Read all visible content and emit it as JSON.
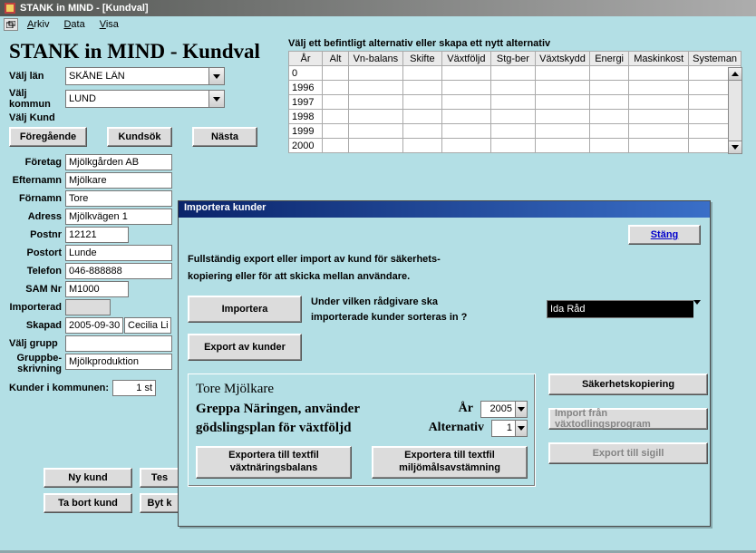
{
  "window": {
    "title": "STANK in MIND - [Kundval]"
  },
  "menubar": {
    "items": [
      "Arkiv",
      "Data",
      "Visa"
    ]
  },
  "app_title": "STANK in MIND - Kundval",
  "selectors": {
    "lan_label": "Välj län",
    "lan_value": "SKÅNE LÄN",
    "kommun_label": "Välj kommun",
    "kommun_value": "LUND",
    "kund_label": "Välj Kund"
  },
  "nav": {
    "prev": "Föregående",
    "search": "Kundsök",
    "next": "Nästa"
  },
  "fields": {
    "foretag_label": "Företag",
    "foretag": "Mjölkgården AB",
    "efternamn_label": "Efternamn",
    "efternamn": "Mjölkare",
    "fornamn_label": "Förnamn",
    "fornamn": "Tore",
    "adress_label": "Adress",
    "adress": "Mjölkvägen 1",
    "postnr_label": "Postnr",
    "postnr": "12121",
    "postort_label": "Postort",
    "postort": "Lunde",
    "telefon_label": "Telefon",
    "telefon": "046-888888",
    "samnr_label": "SAM Nr",
    "samnr": "M1000",
    "importerad_label": "Importerad",
    "importerad": "",
    "skapad_label": "Skapad",
    "skapad_date": "2005-09-30",
    "skapad_by": "Cecilia Li",
    "valj_grupp_label": "Välj grupp",
    "gruppbe_label": "Gruppbe-\nskrivning",
    "gruppbe": "Mjölkproduktion",
    "kunder_i_kommunen_label": "Kunder i kommunen:",
    "kunder_i_kommunen": "1 st"
  },
  "bottom": {
    "ny_kund": "Ny kund",
    "test": "Tes",
    "ta_bort": "Ta bort kund",
    "byt_k": "Byt k"
  },
  "grid": {
    "caption": "Välj ett befintligt alternativ eller skapa ett nytt alternativ",
    "headers": [
      "År",
      "Alt",
      "Vn-balans",
      "Skifte",
      "Växtföljd",
      "Stg-ber",
      "Växtskydd",
      "Energi",
      "Maskinkost",
      "Systeman"
    ],
    "rows": [
      [
        "0",
        "",
        "",
        "",
        "",
        "",
        "",
        "",
        "",
        ""
      ],
      [
        "1996",
        "",
        "",
        "",
        "",
        "",
        "",
        "",
        "",
        ""
      ],
      [
        "1997",
        "",
        "",
        "",
        "",
        "",
        "",
        "",
        "",
        ""
      ],
      [
        "1998",
        "",
        "",
        "",
        "",
        "",
        "",
        "",
        "",
        ""
      ],
      [
        "1999",
        "",
        "",
        "",
        "",
        "",
        "",
        "",
        "",
        ""
      ],
      [
        "2000",
        "",
        "",
        "",
        "",
        "",
        "",
        "",
        "",
        ""
      ]
    ]
  },
  "modal": {
    "title": "Importera kunder",
    "close": "Stäng",
    "desc_l1": "Fullständig export eller import av kund för säkerhets-",
    "desc_l2": "kopiering eller för att skicka mellan användare.",
    "import_btn": "Importera",
    "question_l1": "Under vilken rådgivare ska",
    "question_l2": "importerade kunder sorteras in ?",
    "radgivare": "Ida Råd",
    "export_btn": "Export av kunder",
    "person": "Tore Mjölkare",
    "greppa_l1": "Greppa Näringen, använder",
    "greppa_l2": "gödslingsplan för växtföljd",
    "ar_label": "År",
    "ar_value": "2005",
    "alt_label": "Alternativ",
    "alt_value": "1",
    "export_text1_l1": "Exportera till textfil",
    "export_text1_l2": "växtnäringsbalans",
    "export_text2_l1": "Exportera till textfil",
    "export_text2_l2": "miljömålsavstämning",
    "backup": "Säkerhetskopiering",
    "import_prog": "Import från växtodlingsprogram",
    "export_sigill": "Export till sigill"
  }
}
